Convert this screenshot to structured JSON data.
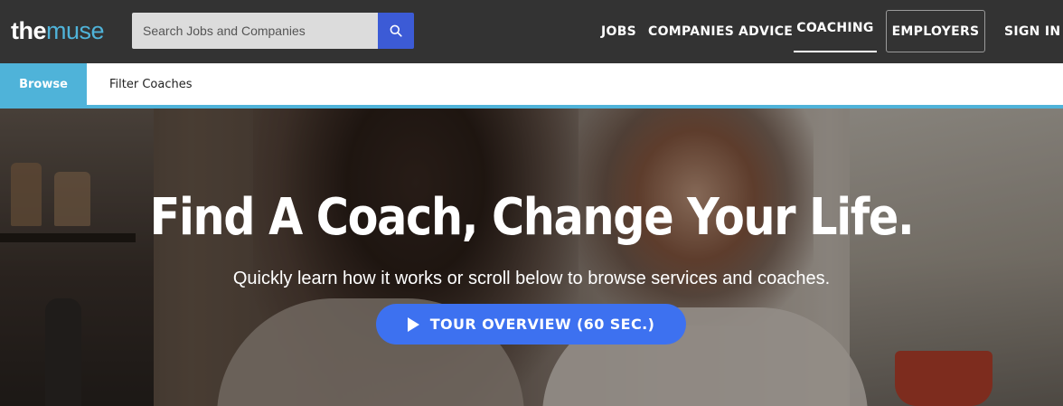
{
  "header": {
    "logo_the": "the",
    "logo_muse": "muse",
    "search_placeholder": "Search Jobs and Companies",
    "nav": {
      "jobs": "JOBS",
      "companies": "COMPANIES",
      "advice": "ADVICE",
      "coaching": "COACHING",
      "employers": "EMPLOYERS",
      "sign_in": "SIGN IN"
    },
    "active_nav": "COACHING"
  },
  "subnav": {
    "browse": "Browse",
    "filter_coaches": "Filter Coaches"
  },
  "hero": {
    "title": "Find A Coach, Change Your Life.",
    "subtitle": "Quickly learn how it works or scroll below to browse services and coaches.",
    "tour_button": "TOUR OVERVIEW (60 SEC.)"
  },
  "colors": {
    "header_bg": "#333333",
    "accent_blue": "#4fb3d9",
    "search_button": "#3c5bd6",
    "tour_button": "#3d71f0"
  },
  "icons": {
    "search": "search-icon",
    "play": "play-icon"
  }
}
